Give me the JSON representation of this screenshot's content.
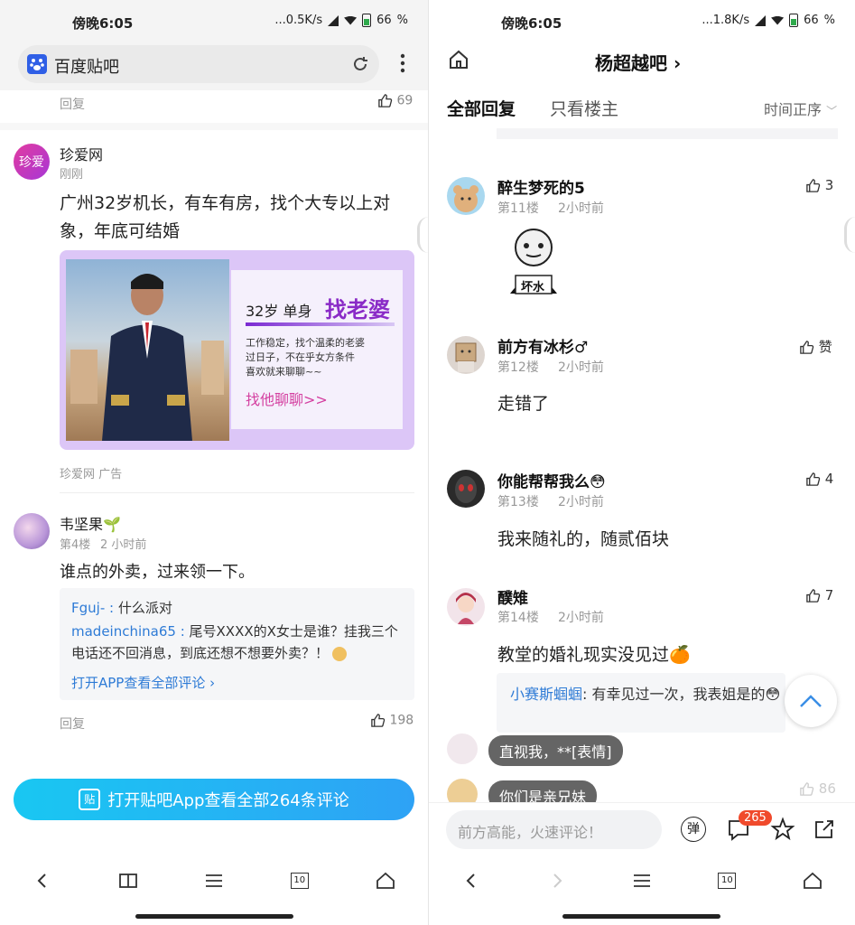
{
  "status": {
    "time": "傍晚6:05",
    "left_net": "...0.5K/s",
    "right_net": "...1.8K/s",
    "battery": "66"
  },
  "left": {
    "browser": {
      "title": "百度贴吧"
    },
    "top_row": {
      "reply": "回复",
      "likes": "69"
    },
    "ad": {
      "author": "珍爱网",
      "time": "刚刚",
      "avatar_text": "珍爱",
      "text": "广州32岁机长，有车有房，找个大专以上对象，年底可结婚",
      "card_head": "32岁  单身",
      "card_highlight": "找老婆",
      "card_body_1": "工作稳定，找个温柔的老婆",
      "card_body_2": "过日子，不在乎女方条件",
      "card_body_3": "喜欢就来聊聊~~",
      "card_cta": "找他聊聊>>",
      "source": "珍爱网 广告"
    },
    "post": {
      "author": "韦坚果🌱",
      "floor": "第4楼",
      "time": "2 小时前",
      "text": "谁点的外卖，过来领一下。",
      "replies": [
        {
          "user": "Fguj-",
          "text": "什么派对"
        },
        {
          "user": "madeinchina65",
          "text": "尾号XXXX的X女士是谁？挂我三个电话还不回消息，到底还想不想要外卖？！"
        }
      ],
      "open_app": "打开APP查看全部评论 ›",
      "reply": "回复",
      "likes": "198"
    },
    "cta_button": "打开贴吧App查看全部264条评论"
  },
  "right": {
    "header": {
      "title": "杨超越吧 ›"
    },
    "tabs": {
      "all": "全部回复",
      "owner": "只看楼主",
      "sort": "时间正序"
    },
    "posts": [
      {
        "author": "醉生梦死的5",
        "floor": "第11楼",
        "time": "2小时前",
        "likes": "3",
        "sticker": "坏水"
      },
      {
        "author": "前方有冰杉♂",
        "floor": "第12楼",
        "time": "2小时前",
        "likes": "赞",
        "text": "走错了"
      },
      {
        "author": "你能帮帮我么😳",
        "floor": "第13楼",
        "time": "2小时前",
        "likes": "4",
        "text": "我来随礼的，随贰佰块"
      },
      {
        "author": "醭雉",
        "floor": "第14楼",
        "time": "2小时前",
        "likes": "7",
        "text": "教堂的婚礼现实没见过🍊",
        "reply_user": "小赛斯蝈蝈",
        "reply_text": "有幸见过一次，我表姐是的😳"
      }
    ],
    "danmaku": [
      "直视我，**[表情]",
      "你们是亲兄妹"
    ],
    "faded_likes": "86",
    "comment_bar": {
      "placeholder": "前方高能，火速评论！",
      "danmu": "弹",
      "count": "265"
    }
  },
  "nav": {
    "tabs_count": "10"
  },
  "colors": {
    "accent_blue": "#2e7bd6",
    "cta_gradient_start": "#19c7f2",
    "cta_gradient_end": "#2ea2f5",
    "badge": "#f04a2c",
    "purple": "#8a2bc7",
    "pink": "#d43fa0"
  }
}
